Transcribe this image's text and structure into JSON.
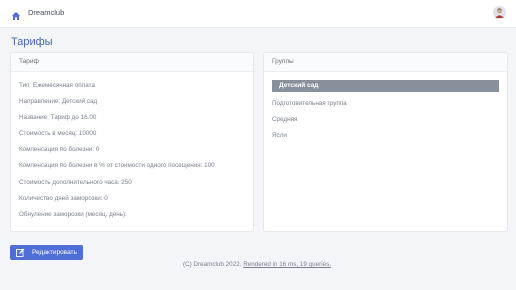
{
  "header": {
    "brand": "Dreamclub",
    "home_icon": "home-icon",
    "avatar_icon": "user-avatar"
  },
  "page": {
    "title": "Тарифы"
  },
  "tariff_card": {
    "title": "Тариф",
    "fields": [
      "Тип: Ежемесячная оплата",
      "Направление: Детский сад",
      "Название: Тариф до 16.00",
      "Стоимость в месяц: 10000",
      "Компенсация по болезни: 0",
      "Компенсация по болезни в % от стоимости одного посещения: 100",
      "Стоимость дополнительного часа: 250",
      "Количество дней заморозки: 0",
      "Обнуление заморозки (месяц, день):"
    ]
  },
  "groups_card": {
    "title": "Группы",
    "items": [
      "Детский сад",
      "Подготовительная группа",
      "Средняя",
      "Ясли"
    ],
    "active_index": 0
  },
  "actions": {
    "edit_label": "Редактировать",
    "edit_icon": "edit-icon"
  },
  "footer": {
    "copyright": "(C) Dreamclub 2022.",
    "render_info": "Rendered in 16 ms, 19 queries."
  },
  "colors": {
    "accent": "#4f6fd6",
    "title": "#3f63b8",
    "active_group": "#8a8f9c"
  }
}
